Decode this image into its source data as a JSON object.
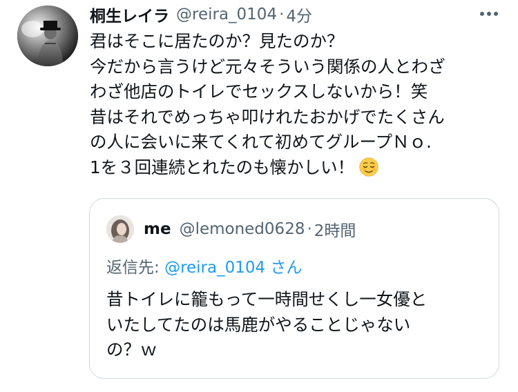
{
  "tweet": {
    "display_name": "桐生レイラ",
    "handle": "@reira_0104",
    "separator": "·",
    "time": "4分",
    "more_icon": "more-horizontal-icon",
    "body_lines": [
      "君はそこに居たのか？見たのか？",
      "今だから言うけど元々そういう関係の人とわざ",
      "わざ他店のトイレでセックスしないから！笑",
      "昔はそれでめっちゃ叩けれたおかげでたくさん",
      "の人に会いに来てくれて初めてグループＮｏ.",
      "1を３回連続とれたのも懐かしい！"
    ],
    "emoji": "relieved-face-emoji"
  },
  "quote": {
    "display_name": "me",
    "handle": "@lemoned0628",
    "separator": "·",
    "time": "2時間",
    "reply_prefix": "返信先: ",
    "reply_mention": "@reira_0104 さん",
    "body_lines": [
      "昔トイレに籠もって一時間せくし一女優と",
      "いたしてたのは馬鹿がやることじゃない",
      "の？ｗ"
    ]
  },
  "colors": {
    "text": "#0f1419",
    "secondary": "#536471",
    "link": "#1d9bf0",
    "border": "#cfd9de"
  }
}
